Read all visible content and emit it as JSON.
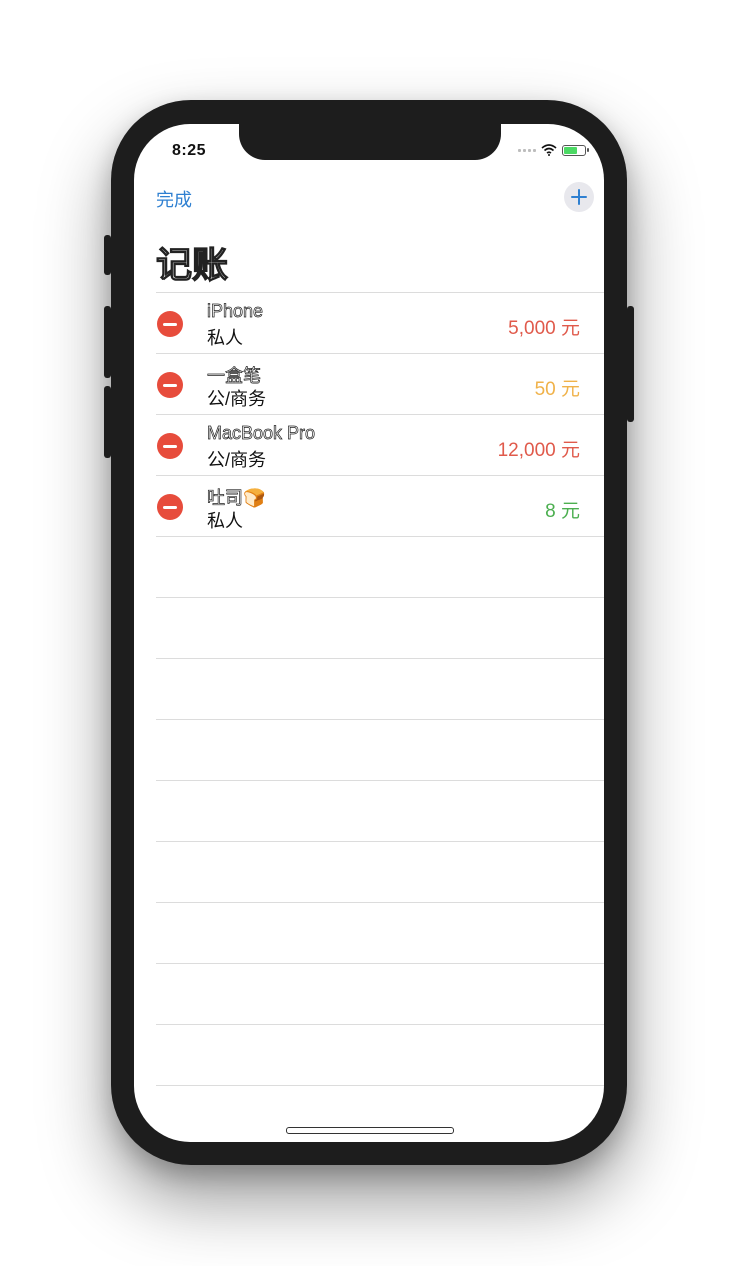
{
  "status": {
    "time": "8:25"
  },
  "nav": {
    "done_label": "完成",
    "add_icon": "plus-icon"
  },
  "page": {
    "title": "记账"
  },
  "items": [
    {
      "name": "iPhone",
      "category": "私人",
      "amount": "5,000 元",
      "color": "#e05a4b"
    },
    {
      "name": "一盒笔",
      "category": "公/商务",
      "amount": "50 元",
      "color": "#f0b24a"
    },
    {
      "name": "MacBook Pro",
      "category": "公/商务",
      "amount": "12,000 元",
      "color": "#e05a4b"
    },
    {
      "name": "吐司🍞",
      "category": "私人",
      "amount": "8 元",
      "color": "#4caf50"
    }
  ],
  "colors": {
    "accent": "#2f80d1",
    "delete": "#e74c3c"
  }
}
